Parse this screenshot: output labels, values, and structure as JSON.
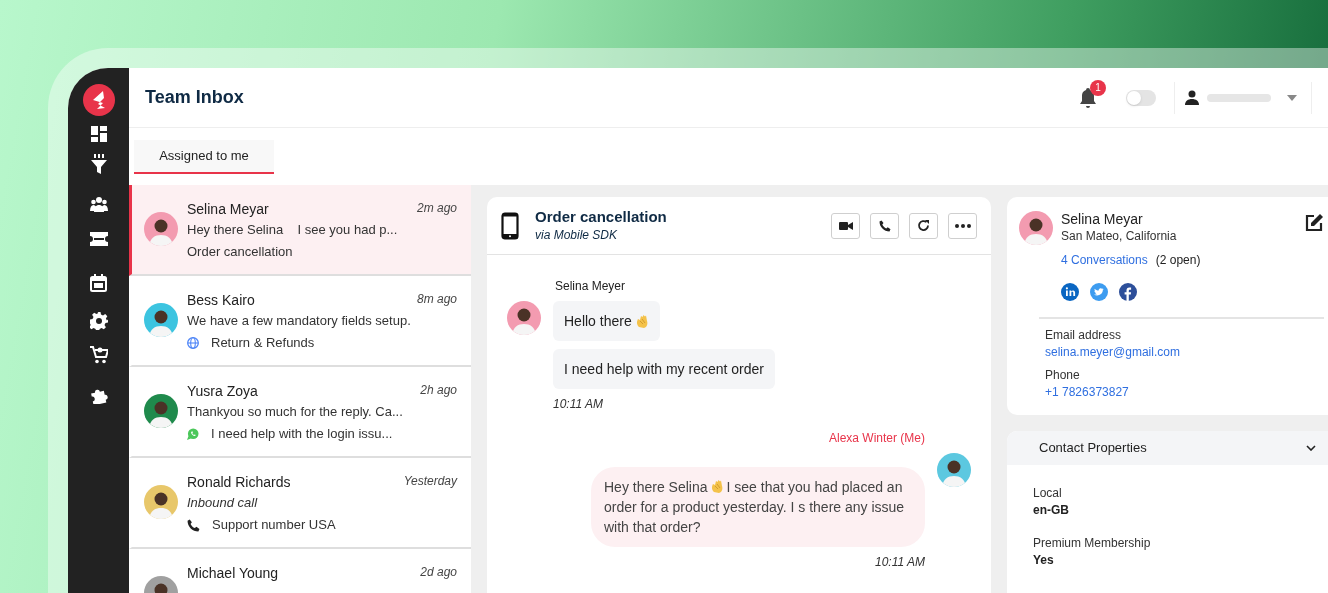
{
  "header": {
    "title": "Team Inbox",
    "notification_count": "1",
    "dark_mode_toggle": {
      "on": false
    }
  },
  "tabs": [
    {
      "label": "Assigned to me",
      "selected": true
    }
  ],
  "conversations": [
    {
      "name": "Selina Meyar",
      "time": "2m ago",
      "preview": "Hey there Selina    I see you had p...",
      "subject": "Order cancellation",
      "kind": "plain",
      "color": "#f39bb0",
      "selected": true
    },
    {
      "name": "Bess Kairo",
      "time": "8m ago",
      "preview": "We have a few mandatory fields setup.",
      "subject": "Return & Refunds",
      "kind": "web",
      "color": "#3cc4e0",
      "selected": false
    },
    {
      "name": "Yusra Zoya",
      "time": "2h ago",
      "preview": "Thankyou so much for the reply. Ca...",
      "subject": "I need help with the login issu...",
      "kind": "whatsapp",
      "color": "#1f8a4c",
      "selected": false
    },
    {
      "name": "Ronald Richards",
      "time": "Yesterday",
      "preview": "Inbound call",
      "subject": "Support number USA",
      "kind": "call",
      "color": "#e8c76a",
      "selected": false
    },
    {
      "name": "Michael Young",
      "time": "2d ago",
      "color": "#a0a0a0",
      "selected": false
    }
  ],
  "chat": {
    "title": "Order cancellation",
    "subtitle": "via Mobile SDK",
    "messages": [
      {
        "kind": "incoming",
        "sender": "Selina Meyer",
        "color": "#f39bb0",
        "bubbles": [
          {
            "text": "Hello there",
            "emoji": true
          },
          {
            "text": "I need help with my recent order",
            "emoji": false
          }
        ],
        "time": "10:11 AM"
      },
      {
        "kind": "outgoing",
        "sender": "Alexa Winter (Me)",
        "color": "#5cc8e0",
        "bubbles": [
          {
            "text": "Hey there Selina",
            "emoji": true,
            "text_after": "I see that you had placed an order for a product yesterday. I s there any issue with that order?"
          }
        ],
        "time": "10:11 AM"
      }
    ]
  },
  "contact": {
    "name": "Selina Meyar",
    "location": "San Mateo, California",
    "conversations_link": "4 Conversations",
    "open_count": "(2 open)",
    "fields": [
      {
        "label": "Email address",
        "value": "selina.meyer@gmail.com"
      },
      {
        "label": "Phone",
        "value": "+1 7826373827"
      }
    ]
  },
  "contact_properties": {
    "title": "Contact Properties",
    "expanded": true,
    "fields": [
      {
        "label": "Local",
        "value": "en-GB"
      },
      {
        "label": "Premium Membership",
        "value": "Yes"
      }
    ]
  }
}
